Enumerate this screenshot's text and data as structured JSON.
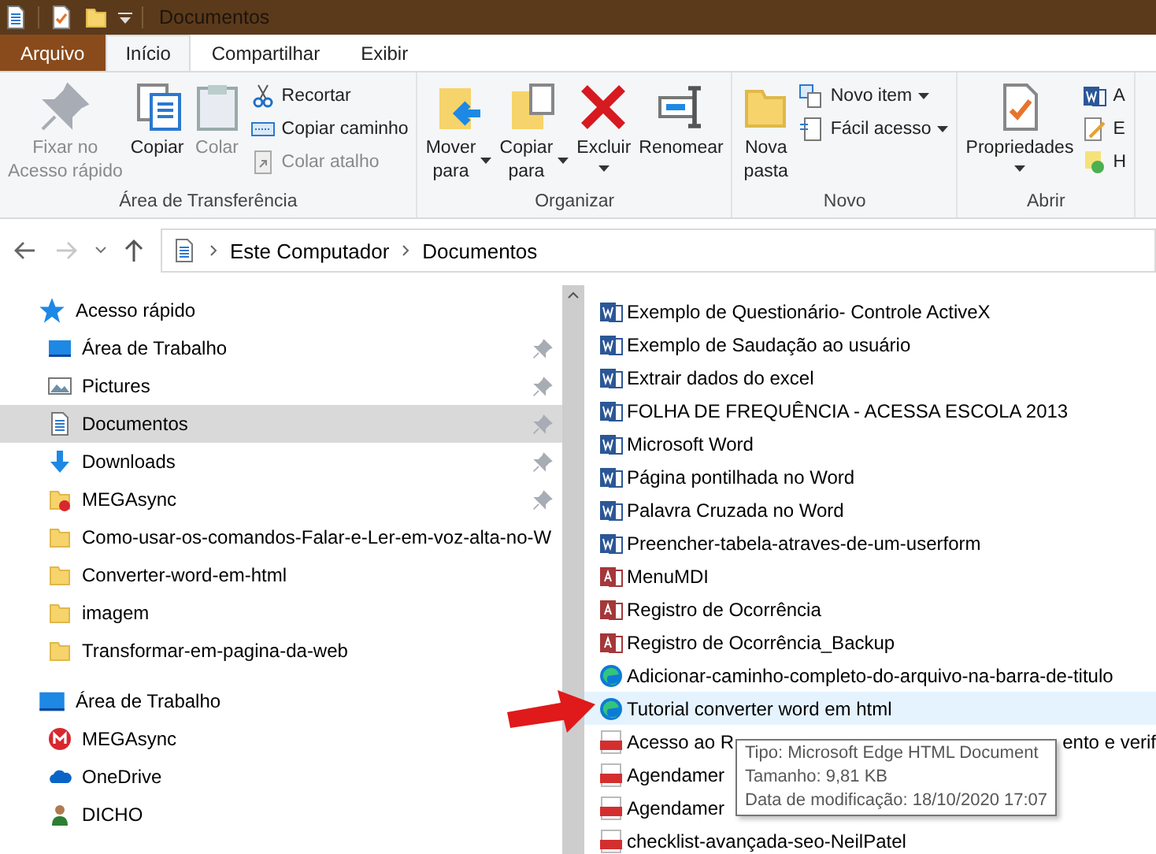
{
  "window": {
    "title": "Documentos"
  },
  "tabs": [
    {
      "label": "Arquivo",
      "kind": "file",
      "selected": false
    },
    {
      "label": "Início",
      "kind": "tab",
      "selected": true
    },
    {
      "label": "Compartilhar",
      "kind": "tab",
      "selected": false
    },
    {
      "label": "Exibir",
      "kind": "tab",
      "selected": false
    }
  ],
  "ribbon": {
    "groups": [
      {
        "label": "Área de Transferência",
        "items": [
          {
            "kind": "pin",
            "label": "Fixar no\nAcesso rápido",
            "disabled": true,
            "dropdown": false
          },
          {
            "kind": "copy",
            "label": "Copiar",
            "disabled": false,
            "dropdown": false
          },
          {
            "kind": "paste",
            "label": "Colar",
            "disabled": true,
            "dropdown": false
          },
          {
            "kind": "stack",
            "items": [
              {
                "kind": "scissors",
                "label": "Recortar",
                "disabled": false,
                "dropdown": false
              },
              {
                "kind": "path",
                "label": "Copiar caminho",
                "disabled": false,
                "dropdown": false
              },
              {
                "kind": "shortcut",
                "label": "Colar atalho",
                "disabled": true,
                "dropdown": false
              }
            ]
          }
        ]
      },
      {
        "label": "Organizar",
        "items": [
          {
            "kind": "move",
            "label": "Mover\npara",
            "disabled": false,
            "dropdown": true
          },
          {
            "kind": "copyto",
            "label": "Copiar\npara",
            "disabled": false,
            "dropdown": true
          },
          {
            "kind": "delete",
            "label": "Excluir",
            "disabled": false,
            "dropdown": true
          },
          {
            "kind": "rename",
            "label": "Renomear",
            "disabled": false,
            "dropdown": false
          }
        ]
      },
      {
        "label": "Novo",
        "items": [
          {
            "kind": "folder",
            "label": "Nova\npasta",
            "disabled": false,
            "dropdown": false
          },
          {
            "kind": "stack",
            "items": [
              {
                "kind": "newitem",
                "label": "Novo item",
                "disabled": false,
                "dropdown": true
              },
              {
                "kind": "easy",
                "label": "Fácil acesso",
                "disabled": false,
                "dropdown": true
              }
            ]
          }
        ]
      },
      {
        "label": "Abrir",
        "items": [
          {
            "kind": "props",
            "label": "Propriedades",
            "disabled": false,
            "dropdown": true
          },
          {
            "kind": "stack",
            "items": [
              {
                "kind": "word",
                "label": "A",
                "disabled": false
              },
              {
                "kind": "edit",
                "label": "E",
                "disabled": false
              },
              {
                "kind": "history",
                "label": "H",
                "disabled": false
              }
            ]
          }
        ]
      }
    ]
  },
  "address": {
    "back_disabled": false,
    "forward_disabled": true,
    "crumbs": [
      "Este Computador",
      "Documentos"
    ]
  },
  "navigation": [
    {
      "label": "Acesso rápido",
      "kind": "star",
      "children": [
        {
          "label": "Área de Trabalho",
          "kind": "desktop",
          "pinned": true,
          "selected": false
        },
        {
          "label": "Pictures",
          "kind": "pictures",
          "pinned": true,
          "selected": false
        },
        {
          "label": "Documentos",
          "kind": "documents",
          "pinned": true,
          "selected": true
        },
        {
          "label": "Downloads",
          "kind": "downloads",
          "pinned": true,
          "selected": false
        },
        {
          "label": "MEGAsync",
          "kind": "megafolder",
          "pinned": true,
          "selected": false
        },
        {
          "label": "Como-usar-os-comandos-Falar-e-Ler-em-voz-alta-no-W",
          "kind": "folder",
          "pinned": false,
          "selected": false
        },
        {
          "label": "Converter-word-em-html",
          "kind": "folder",
          "pinned": false,
          "selected": false
        },
        {
          "label": "imagem",
          "kind": "folder",
          "pinned": false,
          "selected": false
        },
        {
          "label": "Transformar-em-pagina-da-web",
          "kind": "folder",
          "pinned": false,
          "selected": false
        }
      ]
    },
    {
      "label": "Área de Trabalho",
      "kind": "desktop",
      "children": [
        {
          "label": "MEGAsync",
          "kind": "mega",
          "pinned": false,
          "selected": false
        },
        {
          "label": "OneDrive",
          "kind": "cloud",
          "pinned": false,
          "selected": false
        },
        {
          "label": "DICHO",
          "kind": "user",
          "pinned": false,
          "selected": false
        }
      ]
    }
  ],
  "files": [
    {
      "name": "Exemplo de Questionário- Controle ActiveX",
      "kind": "word",
      "hovered": false
    },
    {
      "name": "Exemplo de Saudação ao usuário",
      "kind": "word",
      "hovered": false
    },
    {
      "name": "Extrair dados do excel",
      "kind": "word",
      "hovered": false
    },
    {
      "name": "FOLHA DE FREQUÊNCIA - ACESSA ESCOLA 2013",
      "kind": "word",
      "hovered": false
    },
    {
      "name": "Microsoft Word",
      "kind": "word",
      "hovered": false
    },
    {
      "name": "Página pontilhada no Word",
      "kind": "word",
      "hovered": false
    },
    {
      "name": "Palavra Cruzada no Word",
      "kind": "word",
      "hovered": false
    },
    {
      "name": "Preencher-tabela-atraves-de-um-userform",
      "kind": "word",
      "hovered": false
    },
    {
      "name": "MenuMDI",
      "kind": "access",
      "hovered": false
    },
    {
      "name": "Registro de Ocorrência",
      "kind": "access",
      "hovered": false
    },
    {
      "name": "Registro de Ocorrência_Backup",
      "kind": "access",
      "hovered": false
    },
    {
      "name": "Adicionar-caminho-completo-do-arquivo-na-barra-de-titulo",
      "kind": "edge",
      "hovered": false
    },
    {
      "name": "Tutorial converter word em html",
      "kind": "edge",
      "hovered": true
    },
    {
      "name": "Acesso ao R",
      "tail": "ento e verif",
      "kind": "pdf",
      "hovered": false
    },
    {
      "name": "Agendamer",
      "kind": "pdf",
      "hovered": false
    },
    {
      "name": "Agendamer",
      "kind": "pdf",
      "hovered": false
    },
    {
      "name": "checklist-avançada-seo-NeilPatel",
      "kind": "pdf",
      "hovered": false
    }
  ],
  "tooltip": {
    "lines": [
      "Tipo: Microsoft Edge HTML Document",
      "Tamanho: 9,81 KB",
      "Data de modificação: 18/10/2020 17:07"
    ]
  }
}
